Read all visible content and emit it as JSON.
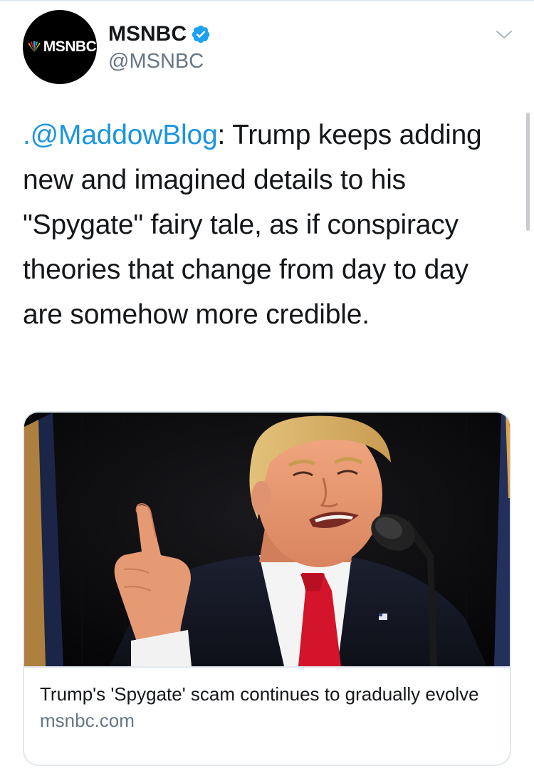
{
  "account": {
    "avatar_text": "MSNBC",
    "display_name": "MSNBC",
    "handle": "@MSNBC",
    "verified": true
  },
  "tweet": {
    "mention": ".@MaddowBlog",
    "body": ": Trump keeps adding new and imagined details to his \"Spygate\" fairy tale, as if conspiracy theories that change from day to day are somehow more credible."
  },
  "card": {
    "title": "Trump's 'Spygate' scam continues to gradually evolve",
    "domain": "msnbc.com"
  },
  "icons": {
    "verified": "verified-badge-icon",
    "menu": "chevron-down-icon",
    "logo": "nbc-peacock-icon"
  },
  "colors": {
    "link": "#1b95e0",
    "verified": "#1da1f2",
    "secondary_text": "#657786",
    "border": "#e1e8ed"
  }
}
